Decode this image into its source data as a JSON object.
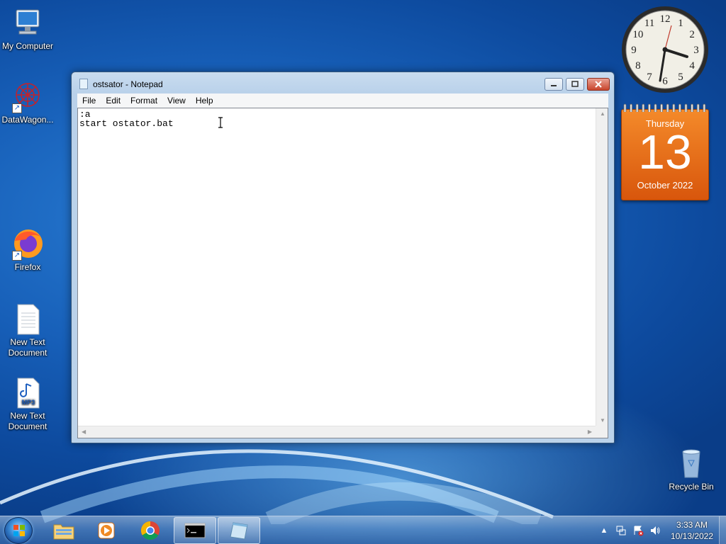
{
  "desktop": {
    "icons": [
      {
        "label": "My Computer",
        "icon": "computer-icon"
      },
      {
        "label": "DataWagon...",
        "icon": "datawagon-icon"
      },
      {
        "label": "Firefox",
        "icon": "firefox-icon"
      },
      {
        "label": "New Text Document",
        "icon": "text-file-icon"
      },
      {
        "label": "New Text Document",
        "icon": "mp3-file-icon",
        "badge": "MP3"
      },
      {
        "label": "Recycle Bin",
        "icon": "recycle-bin-icon"
      }
    ]
  },
  "gadgets": {
    "clock": {
      "numbers": [
        "12",
        "1",
        "2",
        "3",
        "4",
        "5",
        "6",
        "7",
        "8",
        "9",
        "10",
        "11"
      ],
      "time": "3:33"
    },
    "calendar": {
      "day_name": "Thursday",
      "day_number": "13",
      "month_year": "October 2022"
    }
  },
  "notepad": {
    "title": "ostsator - Notepad",
    "menu": [
      "File",
      "Edit",
      "Format",
      "View",
      "Help"
    ],
    "content": ":a\nstart ostator.bat",
    "buttons": {
      "minimize": "minimize-icon",
      "maximize": "maximize-icon",
      "close": "close-icon"
    }
  },
  "taskbar": {
    "items": [
      {
        "name": "start-button",
        "icon": "windows-logo-icon"
      },
      {
        "name": "explorer",
        "icon": "folder-icon"
      },
      {
        "name": "media-player",
        "icon": "media-player-icon"
      },
      {
        "name": "chrome",
        "icon": "chrome-icon"
      },
      {
        "name": "cmd",
        "icon": "cmd-icon",
        "active": true
      },
      {
        "name": "notepad",
        "icon": "notepad-icon",
        "active": true
      }
    ],
    "tray": {
      "time": "3:33 AM",
      "date": "10/13/2022"
    }
  },
  "colors": {
    "calendar_orange": "#e8711a",
    "titlebar": "#c9dcef",
    "desktop_blue": "#175fb8"
  }
}
